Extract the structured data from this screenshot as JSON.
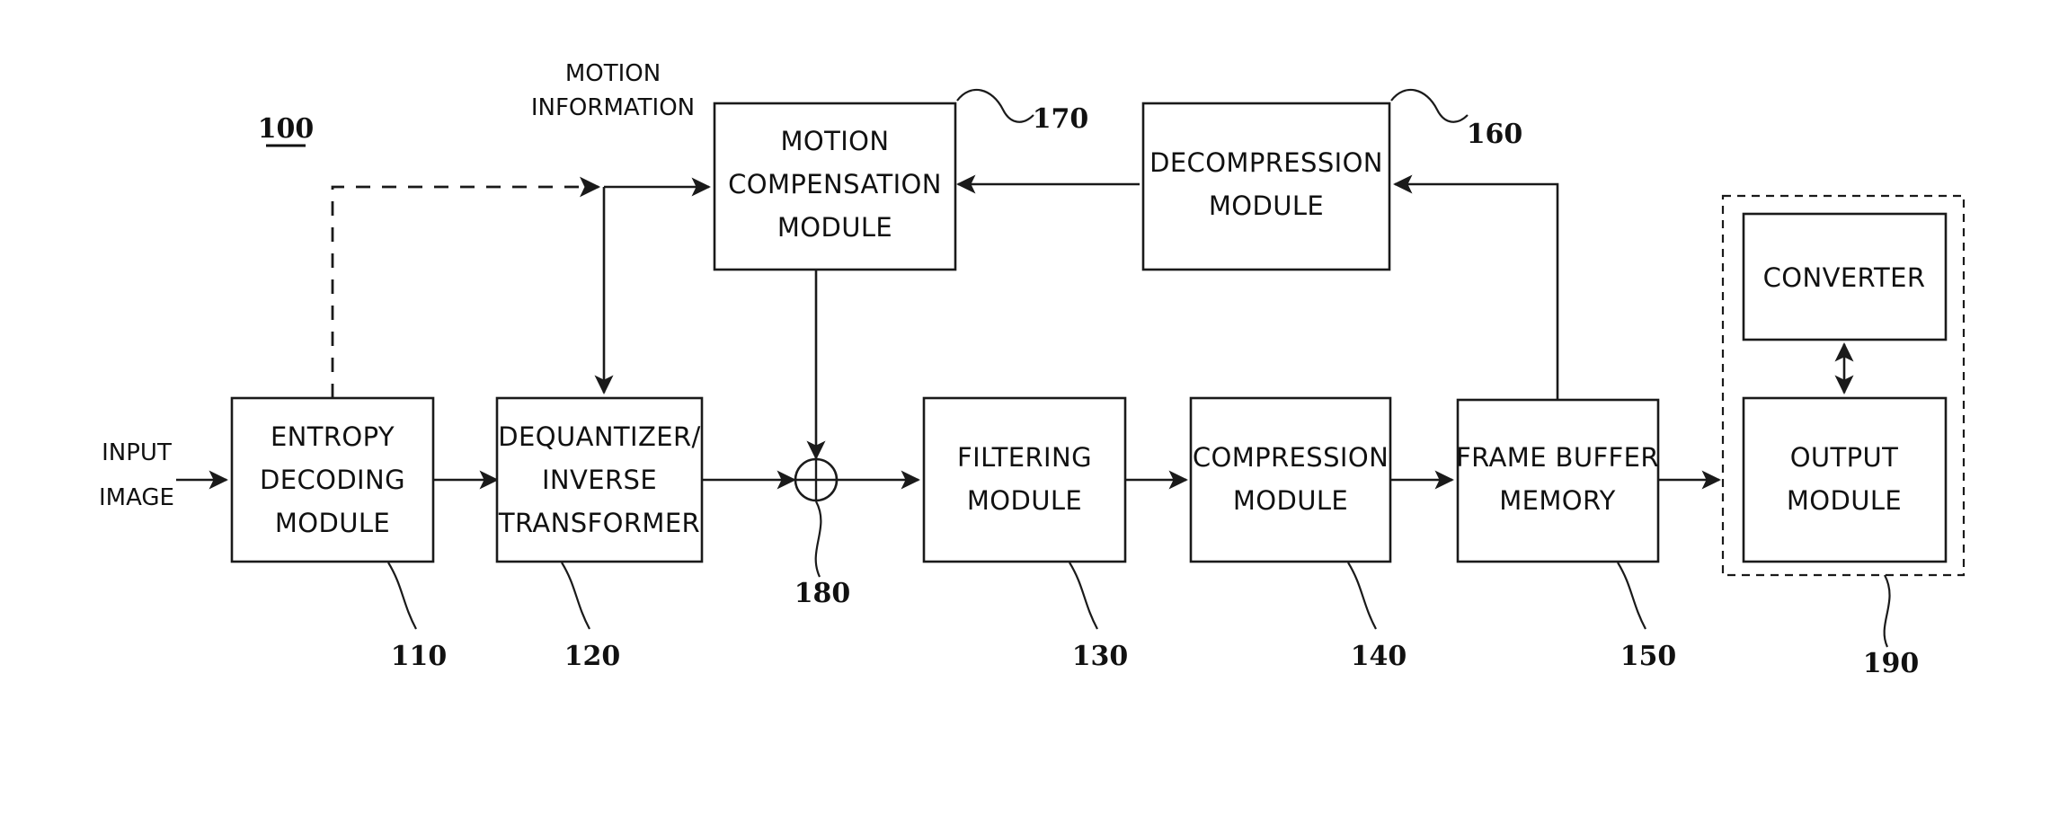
{
  "figure": {
    "main_reference": "100",
    "boxes": [
      {
        "id": "entropy",
        "lines": [
          "ENTROPY",
          "DECODING",
          "MODULE"
        ],
        "ref": "110"
      },
      {
        "id": "dequant",
        "lines": [
          "DEQUANTIZER/",
          "INVERSE",
          "TRANSFORMER"
        ],
        "ref": "120"
      },
      {
        "id": "filtering",
        "lines": [
          "FILTERING",
          "MODULE"
        ],
        "ref": "130"
      },
      {
        "id": "compression",
        "lines": [
          "COMPRESSION",
          "MODULE"
        ],
        "ref": "140"
      },
      {
        "id": "framebuffer",
        "lines": [
          "FRAME BUFFER",
          "MEMORY"
        ],
        "ref": "150"
      },
      {
        "id": "decompression",
        "lines": [
          "DECOMPRESSION",
          "MODULE"
        ],
        "ref": "160"
      },
      {
        "id": "motioncomp",
        "lines": [
          "MOTION",
          "COMPENSATION",
          "MODULE"
        ],
        "ref": "170"
      },
      {
        "id": "converter",
        "lines": [
          "CONVERTER"
        ],
        "ref": ""
      },
      {
        "id": "outputmodule",
        "lines": [
          "OUTPUT",
          "MODULE"
        ],
        "ref": ""
      }
    ],
    "group": {
      "id": "output-group",
      "ref": "190"
    },
    "adder": {
      "id": "summation-node",
      "ref": "180"
    },
    "signals": [
      {
        "id": "input-image",
        "lines": [
          "INPUT",
          "IMAGE"
        ]
      },
      {
        "id": "motion-information",
        "lines": [
          "MOTION",
          "INFORMATION"
        ]
      }
    ],
    "colors": {
      "stroke": "#1a1a1a",
      "text": "#111111",
      "background": "#ffffff"
    }
  }
}
